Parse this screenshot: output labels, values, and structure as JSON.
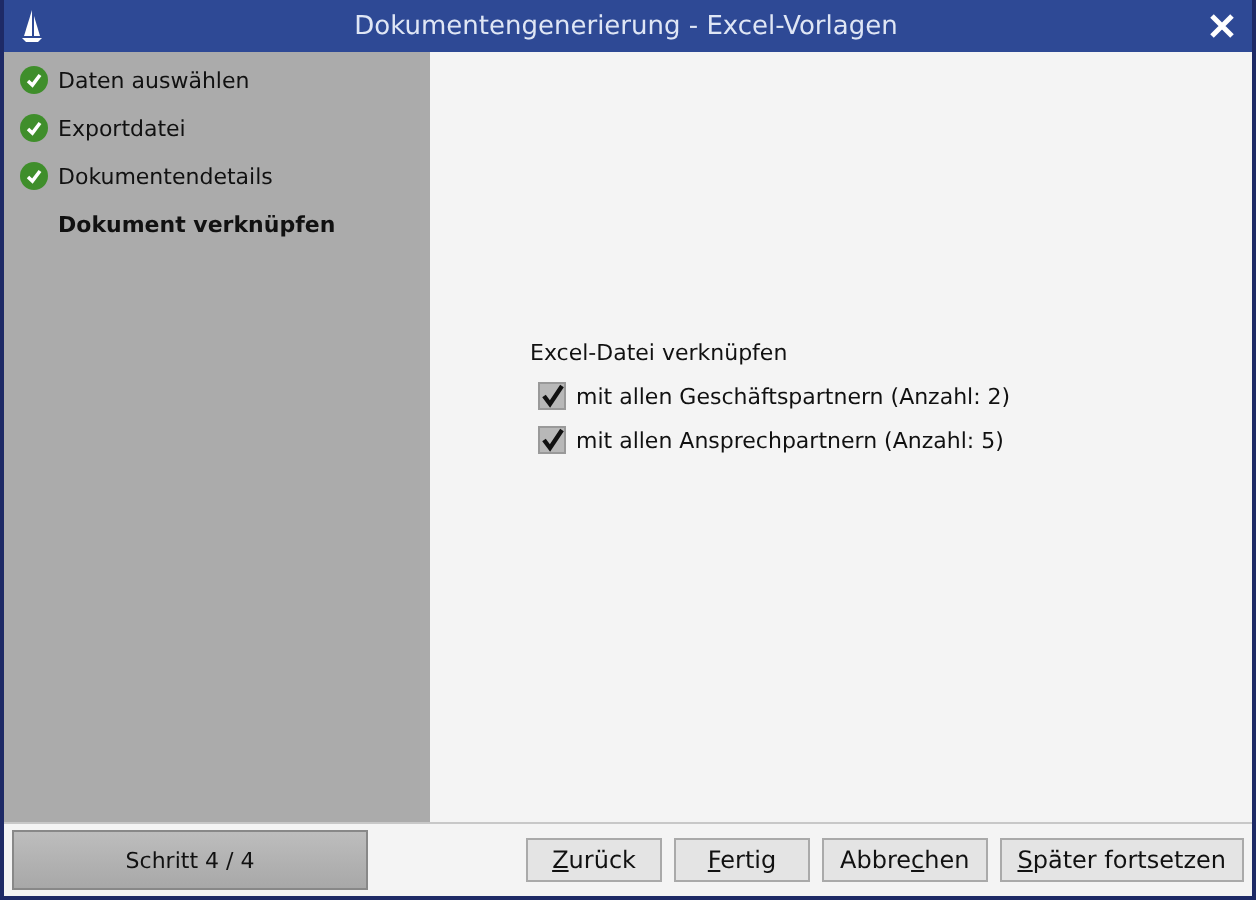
{
  "window": {
    "title": "Dokumentengenerierung - Excel-Vorlagen"
  },
  "steps": [
    {
      "label": "Daten auswählen",
      "done": true,
      "selected": false
    },
    {
      "label": "Exportdatei",
      "done": true,
      "selected": false
    },
    {
      "label": "Dokumentendetails",
      "done": true,
      "selected": false
    },
    {
      "label": "Dokument verknüpfen",
      "done": false,
      "selected": true
    }
  ],
  "section": {
    "title": "Excel-Datei verknüpfen",
    "options": [
      {
        "label": "mit allen Geschäftspartnern (Anzahl: 2)",
        "checked": true
      },
      {
        "label": "mit allen Ansprechpartnern (Anzahl: 5)",
        "checked": true
      }
    ]
  },
  "step_indicator": "Schritt 4 / 4",
  "buttons": [
    {
      "access_key": "Z",
      "after": "urück"
    },
    {
      "access_key": "F",
      "after": "ertig"
    },
    {
      "before": "Abbre",
      "access_key": "c",
      "after": "hen"
    },
    {
      "access_key": "S",
      "after": "päter fortsetzen"
    }
  ]
}
